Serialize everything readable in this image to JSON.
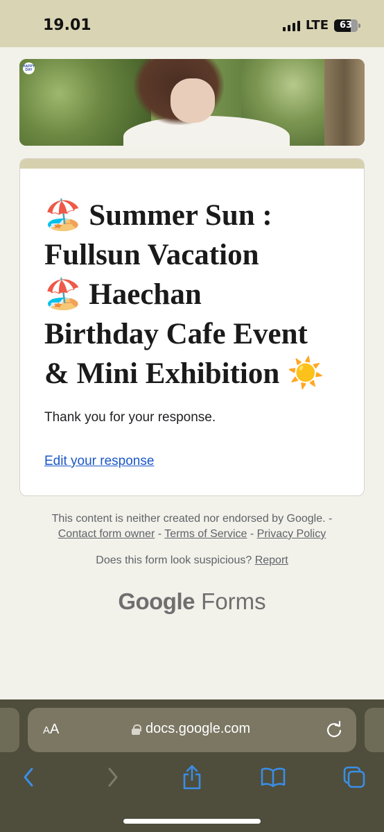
{
  "status_bar": {
    "time": "19.01",
    "network": "LTE",
    "battery": "63"
  },
  "banner": {
    "badge_text": "HAPPY DAY"
  },
  "form": {
    "title": "🏖️ Summer Sun : Fullsun Vacation 🏖️ Haechan Birthday Cafe Event & Mini Exhibition ☀️",
    "title_lines": [
      "🏖️  Summer Sun :",
      "Fullsun Vacation",
      "🏖️    Haechan",
      "Birthday Cafe Event",
      "& Mini Exhibition ☀️"
    ],
    "confirmation_message": "Thank you for your response.",
    "edit_link": "Edit your response"
  },
  "footer": {
    "disclaimer": "This content is neither created nor endorsed by Google. -",
    "contact_link": "Contact form owner",
    "separator": " - ",
    "terms_link": "Terms of Service",
    "privacy_link": "Privacy Policy",
    "suspicious_text": "Does this form look suspicious?",
    "report_link": "Report",
    "brand_google": "Google",
    "brand_forms": "Forms"
  },
  "browser": {
    "aa_label_small": "A",
    "aa_label_large": "A",
    "url": "docs.google.com"
  },
  "colors": {
    "accent_header": "#d6d0ae",
    "link": "#1a56c8",
    "browser_bar": "#4f4d3b",
    "ios_blue": "#3a8ee6"
  },
  "icons": [
    "lock-icon",
    "reload-icon",
    "back-icon",
    "forward-icon",
    "share-icon",
    "bookmarks-icon",
    "tabs-icon"
  ]
}
